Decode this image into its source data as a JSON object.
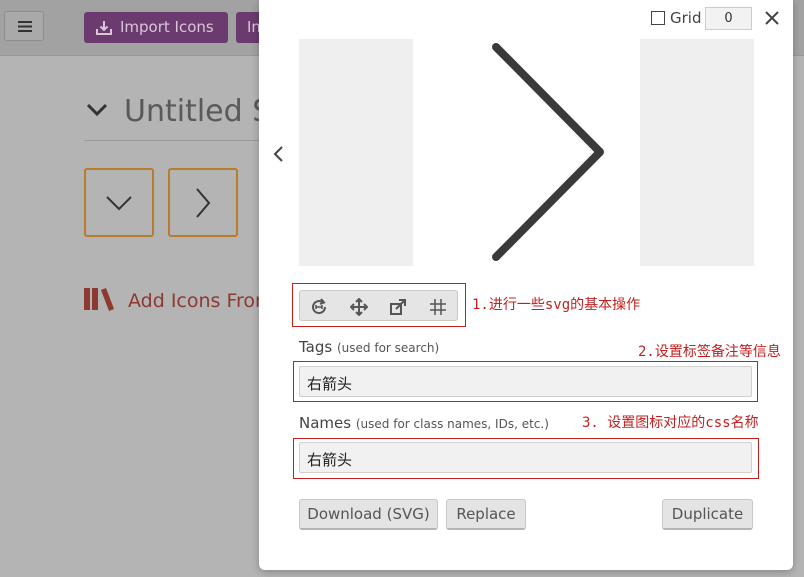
{
  "app": {
    "import_label": "Import Icons",
    "import2_label": "Im",
    "set_title": "Untitled Set",
    "add_icons_label": "Add Icons From Library..."
  },
  "modal": {
    "grid_label": "Grid",
    "grid_value": "0",
    "tags_label": "Tags",
    "tags_hint": "(used for search)",
    "tags_value": "右箭头",
    "names_label": "Names",
    "names_hint": "(used for class names, IDs, etc.)",
    "names_value": "右箭头",
    "download_label": "Download (SVG)",
    "replace_label": "Replace",
    "duplicate_label": "Duplicate"
  },
  "annotations": {
    "a1": "1.进行一些svg的基本操作",
    "a2": "2.设置标签备注等信息",
    "a3": "3. 设置图标对应的css名称"
  },
  "colors": {
    "accent_purple": "#6b3b6f",
    "tile_border": "#b87c2c",
    "annotation_red": "#c21f1f"
  },
  "icons": [
    "menu-icon",
    "import-icon",
    "chevron-down-icon",
    "chevron-right-icon",
    "library-icon",
    "close-icon",
    "chevron-left-icon",
    "rotate-icon",
    "move-icon",
    "scale-icon",
    "grid-icon"
  ]
}
